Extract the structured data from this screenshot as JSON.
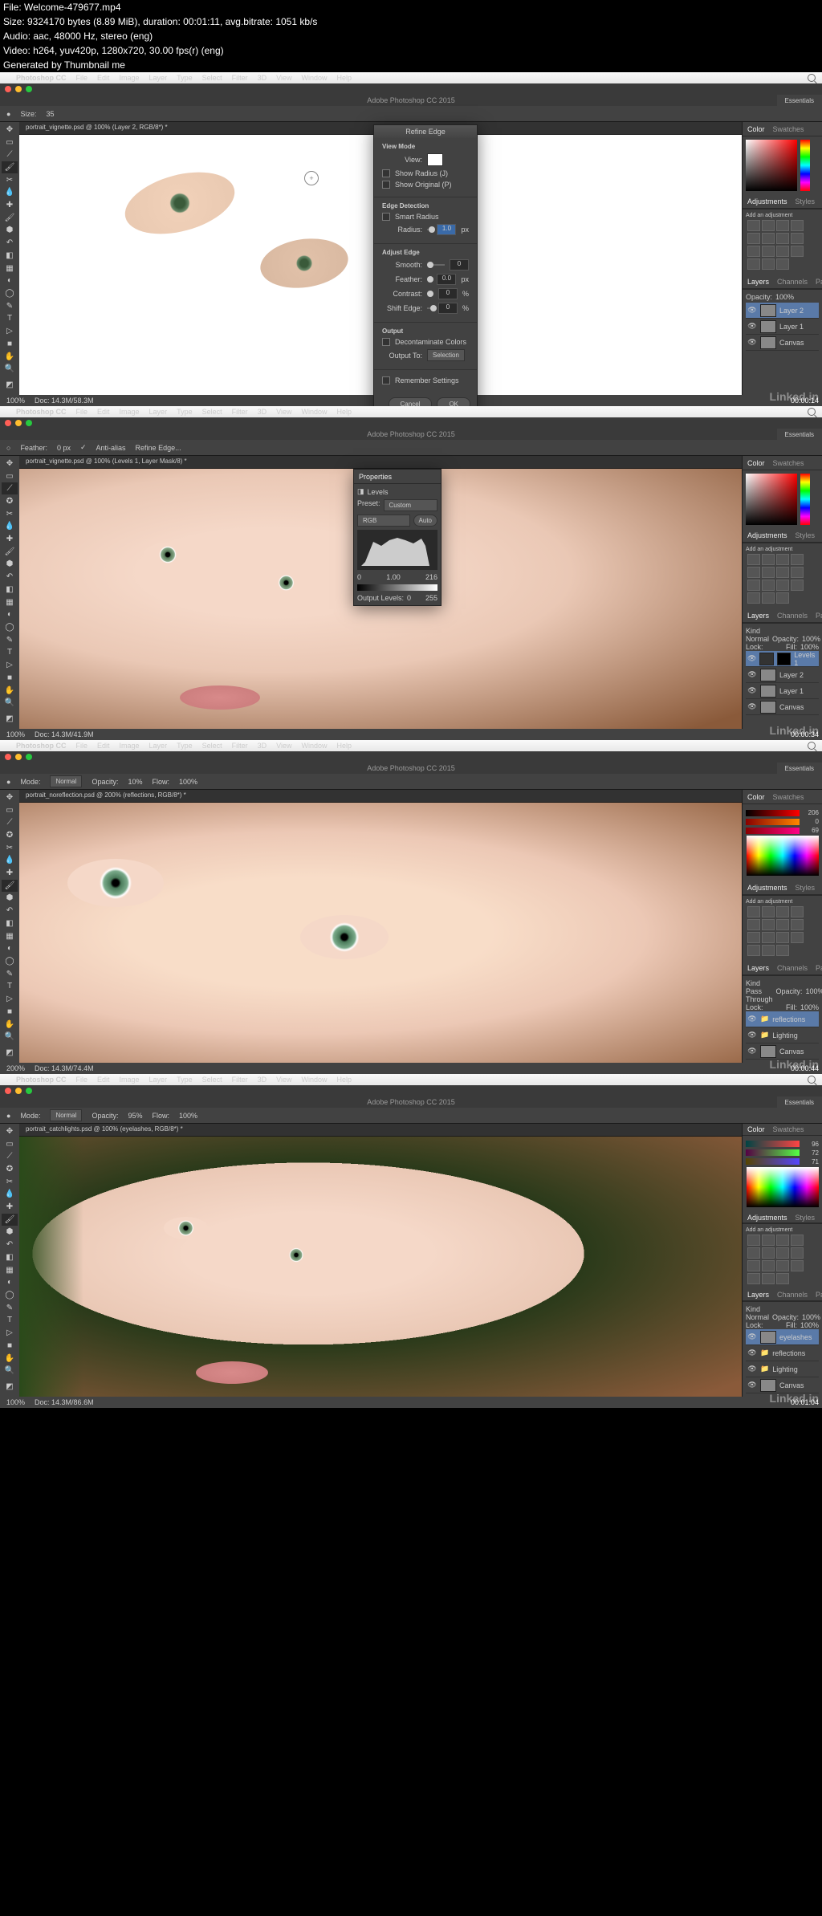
{
  "info": {
    "file": "File: Welcome-479677.mp4",
    "size": "Size: 9324170 bytes (8.89 MiB), duration: 00:01:11, avg.bitrate: 1051 kb/s",
    "audio": "Audio: aac, 48000 Hz, stereo (eng)",
    "video": "Video: h264, yuv420p, 1280x720, 30.00 fps(r) (eng)",
    "generated": "Generated by Thumbnail me"
  },
  "menus": [
    "File",
    "Edit",
    "Image",
    "Layer",
    "Type",
    "Select",
    "Filter",
    "3D",
    "View",
    "Window",
    "Help"
  ],
  "app_name": "Photoshop CC",
  "title": "Adobe Photoshop CC 2015",
  "essentials": "Essentials",
  "watermark": "Linked in",
  "screenshots": [
    {
      "doc_tab": "portrait_vignette.psd @ 100% (Layer 2, RGB/8*) *",
      "options": {
        "size_label": "Size:",
        "size": "35"
      },
      "zoom": "100%",
      "doc_info": "Doc: 14.3M/58.3M",
      "timestamp": "00:00:14",
      "panels": {
        "color_tab": "Color",
        "swatches_tab": "Swatches",
        "adjustments_tab": "Adjustments",
        "styles_tab": "Styles",
        "add_adjustment": "Add an adjustment",
        "layers_tab": "Layers",
        "channels_tab": "Channels",
        "paths_tab": "Paths",
        "opacity_label": "Opacity:",
        "opacity": "100%",
        "layers": [
          "Layer 2",
          "Layer 1",
          "Canvas"
        ]
      },
      "refine_edge": {
        "title": "Refine Edge",
        "view_mode": "View Mode",
        "view": "View:",
        "show_radius": "Show Radius (J)",
        "show_original": "Show Original (P)",
        "edge_detection": "Edge Detection",
        "smart_radius": "Smart Radius",
        "radius": "Radius:",
        "radius_val": "1.0",
        "radius_unit": "px",
        "adjust_edge": "Adjust Edge",
        "smooth": "Smooth:",
        "smooth_val": "0",
        "feather": "Feather:",
        "feather_val": "0.0",
        "feather_unit": "px",
        "contrast": "Contrast:",
        "contrast_val": "0",
        "contrast_unit": "%",
        "shift": "Shift Edge:",
        "shift_val": "0",
        "shift_unit": "%",
        "output": "Output",
        "decontaminate": "Decontaminate Colors",
        "output_to": "Output To:",
        "output_sel": "Selection",
        "remember": "Remember Settings",
        "cancel": "Cancel",
        "ok": "OK"
      }
    },
    {
      "doc_tab": "portrait_vignette.psd @ 100% (Levels 1, Layer Mask/8) *",
      "options": {
        "feather_label": "Feather:",
        "feather": "0 px",
        "antialias": "Anti-alias",
        "refine": "Refine Edge..."
      },
      "zoom": "100%",
      "doc_info": "Doc: 14.3M/41.9M",
      "timestamp": "00:00:34",
      "properties": {
        "title": "Properties",
        "type": "Levels",
        "preset": "Preset:",
        "preset_val": "Custom",
        "channel": "RGB",
        "auto": "Auto",
        "input_vals": [
          "0",
          "1.00",
          "216"
        ],
        "output_label": "Output Levels:",
        "output_vals": [
          "0",
          "255"
        ]
      },
      "panels": {
        "color_tab": "Color",
        "swatches_tab": "Swatches",
        "adjustments_tab": "Adjustments",
        "styles_tab": "Styles",
        "add_adjustment": "Add an adjustment",
        "layers_tab": "Layers",
        "channels_tab": "Channels",
        "paths_tab": "Paths",
        "kind": "Kind",
        "normal": "Normal",
        "opacity_label": "Opacity:",
        "opacity": "100%",
        "lock": "Lock:",
        "fill_label": "Fill:",
        "fill": "100%",
        "layers": [
          "Levels 1",
          "Layer 2",
          "Layer 1",
          "Canvas"
        ]
      }
    },
    {
      "doc_tab": "portrait_noreflection.psd @ 200% (reflections, RGB/8*) *",
      "options": {
        "mode_label": "Mode:",
        "mode": "Normal",
        "opacity_label": "Opacity:",
        "opacity": "10%",
        "flow_label": "Flow:",
        "flow": "100%"
      },
      "zoom": "200%",
      "doc_info": "Doc: 14.3M/74.4M",
      "timestamp": "00:00:44",
      "color_sliders": {
        "r": "206",
        "g": "0",
        "b": "69"
      },
      "panels": {
        "color_tab": "Color",
        "swatches_tab": "Swatches",
        "adjustments_tab": "Adjustments",
        "styles_tab": "Styles",
        "add_adjustment": "Add an adjustment",
        "layers_tab": "Layers",
        "channels_tab": "Channels",
        "paths_tab": "Paths",
        "kind": "Kind",
        "passthrough": "Pass Through",
        "opacity_label": "Opacity:",
        "opacity": "100%",
        "lock": "Lock:",
        "fill_label": "Fill:",
        "fill": "100%",
        "layers": [
          "reflections",
          "Lighting",
          "Canvas"
        ]
      }
    },
    {
      "doc_tab": "portrait_catchlights.psd @ 100% (eyelashes, RGB/8*) *",
      "options": {
        "mode_label": "Mode:",
        "mode": "Normal",
        "opacity_label": "Opacity:",
        "opacity": "95%",
        "flow_label": "Flow:",
        "flow": "100%"
      },
      "zoom": "100%",
      "doc_info": "Doc: 14.3M/86.6M",
      "timestamp": "00:01:04",
      "color_sliders": {
        "r": "96",
        "g": "72",
        "b": "71"
      },
      "panels": {
        "color_tab": "Color",
        "swatches_tab": "Swatches",
        "adjustments_tab": "Adjustments",
        "styles_tab": "Styles",
        "add_adjustment": "Add an adjustment",
        "layers_tab": "Layers",
        "channels_tab": "Channels",
        "paths_tab": "Paths",
        "kind": "Kind",
        "normal": "Normal",
        "opacity_label": "Opacity:",
        "opacity": "100%",
        "lock": "Lock:",
        "fill_label": "Fill:",
        "fill": "100%",
        "layers": [
          "eyelashes",
          "reflections",
          "Lighting",
          "Canvas"
        ]
      }
    }
  ]
}
